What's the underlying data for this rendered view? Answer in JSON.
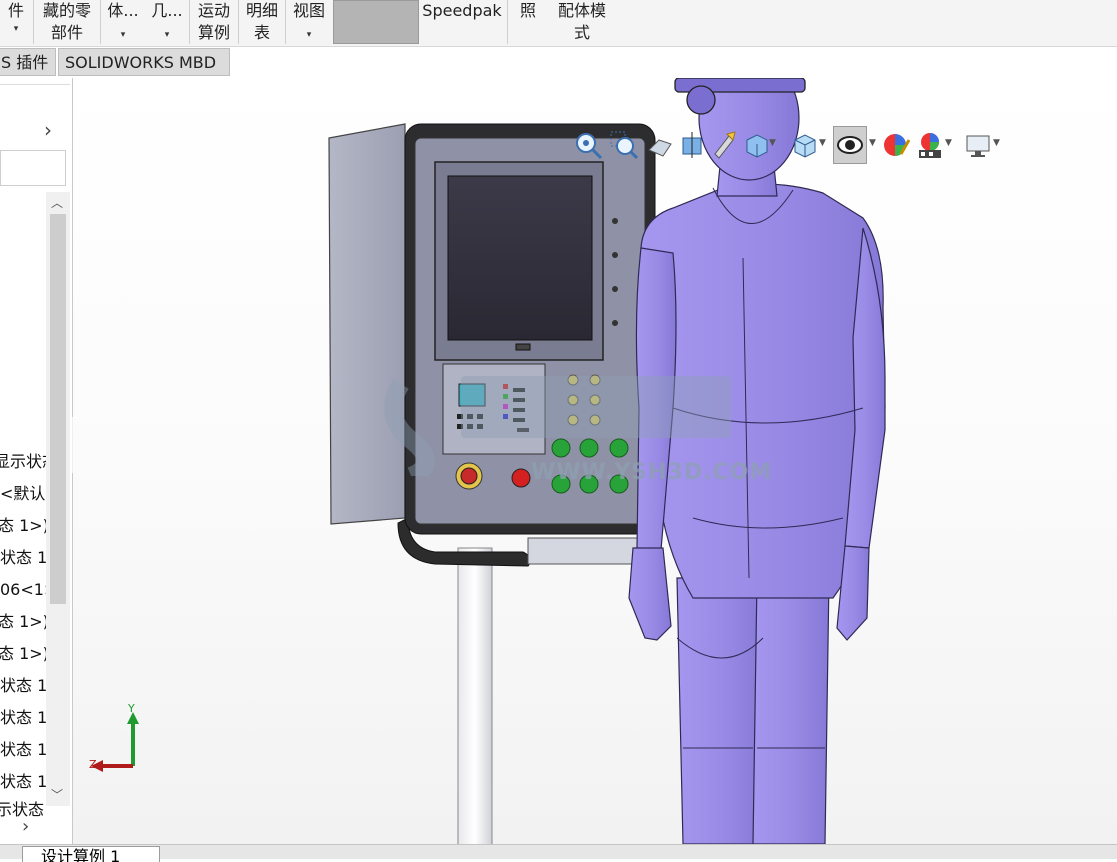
{
  "ribbon": {
    "btn1": "件",
    "btn2_l1": "藏的零",
    "btn2_l2": "部件",
    "btn3": "体...",
    "btn4": "几...",
    "btn5_l1": "运动",
    "btn5_l2": "算例",
    "btn6_l1": "明细",
    "btn6_l2": "表",
    "btn7": "视图",
    "btn8": "Speedpak",
    "btn9": "照",
    "btn10_l1": "配体模",
    "btn10_l2": "式",
    "dropdown_arrow": "▾"
  },
  "tabs": {
    "tab1": "S 插件",
    "tab2": "SOLIDWORKS MBD"
  },
  "left_panel": {
    "items": [
      "显示状态",
      "<默认",
      "态 1>)",
      "状态 1",
      "06<1>",
      "态 1>)",
      "态 1>)",
      "状态 1",
      "状态 1",
      "状态 1",
      "状态 1",
      "示状态"
    ]
  },
  "triad": {
    "y": "Y",
    "z": "Z"
  },
  "watermark": {
    "url": "WWW.YSH3D.COM"
  },
  "bottom_tab": {
    "label": "设计算例 1"
  },
  "colors": {
    "figure_purple": "#9b8de6",
    "cabinet_grey": "#a3a6b8",
    "accent_green": "#27a33a",
    "accent_red": "#d42020"
  }
}
